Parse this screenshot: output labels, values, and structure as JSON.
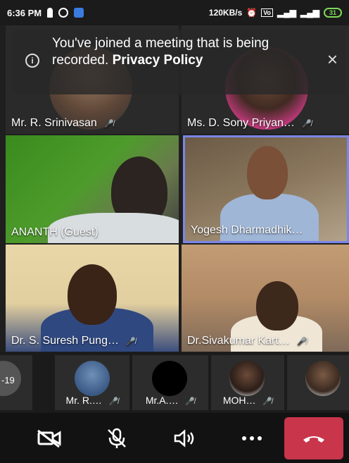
{
  "status_bar": {
    "time": "6:36 PM",
    "network_speed": "120KB/s",
    "battery": "31"
  },
  "banner": {
    "message_prefix": "You've joined a meeting that is being recorded.",
    "message_link": "Privacy Policy"
  },
  "grid_participants": [
    {
      "name": "Mr. R. Srinivasan",
      "muted": true
    },
    {
      "name": "Ms. D. Sony Priyan…",
      "muted": true
    },
    {
      "name": "ANANTH (Guest)",
      "muted": false
    },
    {
      "name": "Yogesh Dharmadhik…",
      "muted": false,
      "active_speaker": true
    },
    {
      "name": "Dr. S. Suresh Pung…",
      "muted": true
    },
    {
      "name": "Dr.Sivakumar Kart…",
      "muted": true
    }
  ],
  "strip_participants": [
    {
      "name": "",
      "label": "-19"
    },
    {
      "name": "Mr. R.…",
      "muted": true
    },
    {
      "name": "Mr.A.…",
      "muted": true
    },
    {
      "name": "MOH…",
      "muted": true
    },
    {
      "name": "",
      "muted": false
    }
  ],
  "controls": {
    "camera": "camera-off-icon",
    "mic": "mic-off-icon",
    "speaker": "speaker-icon",
    "more": "more-icon",
    "hangup": "hang-up-icon"
  },
  "colors": {
    "active_speaker_border": "#7b86e8",
    "hangup": "#c9354a",
    "battery": "#7ed957"
  }
}
